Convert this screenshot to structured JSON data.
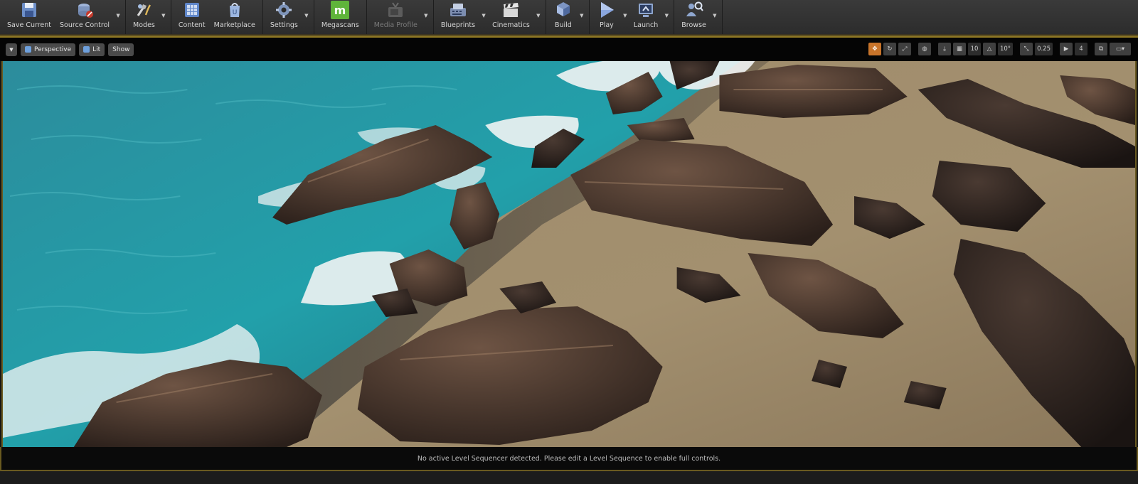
{
  "toolbar": {
    "buttons": [
      {
        "label": "Save Current",
        "icon": "save-icon",
        "has_menu": false,
        "enabled": true
      },
      {
        "label": "Source Control",
        "icon": "source-control-icon",
        "has_menu": true,
        "enabled": true
      },
      {
        "label": "Modes",
        "icon": "modes-icon",
        "has_menu": true,
        "enabled": true
      },
      {
        "label": "Content",
        "icon": "content-icon",
        "has_menu": false,
        "enabled": true
      },
      {
        "label": "Marketplace",
        "icon": "marketplace-icon",
        "has_menu": false,
        "enabled": true
      },
      {
        "label": "Settings",
        "icon": "settings-icon",
        "has_menu": true,
        "enabled": true
      },
      {
        "label": "Megascans",
        "icon": "megascans-icon",
        "has_menu": false,
        "enabled": true
      },
      {
        "label": "Media Profile",
        "icon": "media-profile-icon",
        "has_menu": true,
        "enabled": false
      },
      {
        "label": "Blueprints",
        "icon": "blueprints-icon",
        "has_menu": true,
        "enabled": true
      },
      {
        "label": "Cinematics",
        "icon": "cinematics-icon",
        "has_menu": true,
        "enabled": true
      },
      {
        "label": "Build",
        "icon": "build-icon",
        "has_menu": true,
        "enabled": true
      },
      {
        "label": "Play",
        "icon": "play-icon",
        "has_menu": true,
        "enabled": true
      },
      {
        "label": "Launch",
        "icon": "launch-icon",
        "has_menu": true,
        "enabled": true
      },
      {
        "label": "Browse",
        "icon": "browse-icon",
        "has_menu": true,
        "enabled": true
      }
    ]
  },
  "viewport_toolbar": {
    "view_mode": "Perspective",
    "lighting": "Lit",
    "show": "Show",
    "grid_snap": "10",
    "rotation_snap": "10°",
    "scale_snap": "0.25",
    "camera_speed": "4"
  },
  "sequencer": {
    "message": "No active Level Sequencer detected. Please edit a Level Sequence to enable full controls."
  },
  "colors": {
    "accent_gold": "#8a7424",
    "active_orange": "#c8742a",
    "megascans_green": "#5fb43a"
  }
}
